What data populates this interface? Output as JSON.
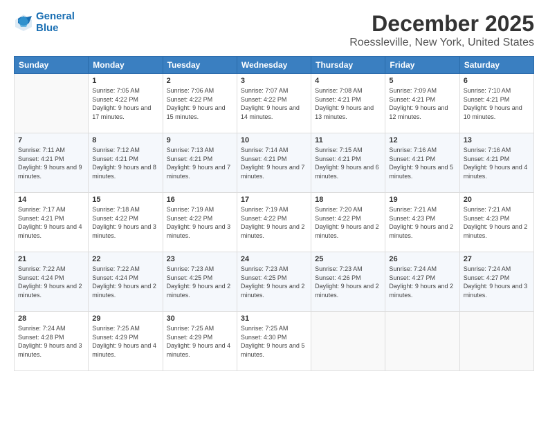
{
  "header": {
    "logo_line1": "General",
    "logo_line2": "Blue",
    "title": "December 2025",
    "subtitle": "Roessleville, New York, United States"
  },
  "weekdays": [
    "Sunday",
    "Monday",
    "Tuesday",
    "Wednesday",
    "Thursday",
    "Friday",
    "Saturday"
  ],
  "weeks": [
    [
      {
        "day": "",
        "sunrise": "",
        "sunset": "",
        "daylight": ""
      },
      {
        "day": "1",
        "sunrise": "Sunrise: 7:05 AM",
        "sunset": "Sunset: 4:22 PM",
        "daylight": "Daylight: 9 hours and 17 minutes."
      },
      {
        "day": "2",
        "sunrise": "Sunrise: 7:06 AM",
        "sunset": "Sunset: 4:22 PM",
        "daylight": "Daylight: 9 hours and 15 minutes."
      },
      {
        "day": "3",
        "sunrise": "Sunrise: 7:07 AM",
        "sunset": "Sunset: 4:22 PM",
        "daylight": "Daylight: 9 hours and 14 minutes."
      },
      {
        "day": "4",
        "sunrise": "Sunrise: 7:08 AM",
        "sunset": "Sunset: 4:21 PM",
        "daylight": "Daylight: 9 hours and 13 minutes."
      },
      {
        "day": "5",
        "sunrise": "Sunrise: 7:09 AM",
        "sunset": "Sunset: 4:21 PM",
        "daylight": "Daylight: 9 hours and 12 minutes."
      },
      {
        "day": "6",
        "sunrise": "Sunrise: 7:10 AM",
        "sunset": "Sunset: 4:21 PM",
        "daylight": "Daylight: 9 hours and 10 minutes."
      }
    ],
    [
      {
        "day": "7",
        "sunrise": "Sunrise: 7:11 AM",
        "sunset": "Sunset: 4:21 PM",
        "daylight": "Daylight: 9 hours and 9 minutes."
      },
      {
        "day": "8",
        "sunrise": "Sunrise: 7:12 AM",
        "sunset": "Sunset: 4:21 PM",
        "daylight": "Daylight: 9 hours and 8 minutes."
      },
      {
        "day": "9",
        "sunrise": "Sunrise: 7:13 AM",
        "sunset": "Sunset: 4:21 PM",
        "daylight": "Daylight: 9 hours and 7 minutes."
      },
      {
        "day": "10",
        "sunrise": "Sunrise: 7:14 AM",
        "sunset": "Sunset: 4:21 PM",
        "daylight": "Daylight: 9 hours and 7 minutes."
      },
      {
        "day": "11",
        "sunrise": "Sunrise: 7:15 AM",
        "sunset": "Sunset: 4:21 PM",
        "daylight": "Daylight: 9 hours and 6 minutes."
      },
      {
        "day": "12",
        "sunrise": "Sunrise: 7:16 AM",
        "sunset": "Sunset: 4:21 PM",
        "daylight": "Daylight: 9 hours and 5 minutes."
      },
      {
        "day": "13",
        "sunrise": "Sunrise: 7:16 AM",
        "sunset": "Sunset: 4:21 PM",
        "daylight": "Daylight: 9 hours and 4 minutes."
      }
    ],
    [
      {
        "day": "14",
        "sunrise": "Sunrise: 7:17 AM",
        "sunset": "Sunset: 4:21 PM",
        "daylight": "Daylight: 9 hours and 4 minutes."
      },
      {
        "day": "15",
        "sunrise": "Sunrise: 7:18 AM",
        "sunset": "Sunset: 4:22 PM",
        "daylight": "Daylight: 9 hours and 3 minutes."
      },
      {
        "day": "16",
        "sunrise": "Sunrise: 7:19 AM",
        "sunset": "Sunset: 4:22 PM",
        "daylight": "Daylight: 9 hours and 3 minutes."
      },
      {
        "day": "17",
        "sunrise": "Sunrise: 7:19 AM",
        "sunset": "Sunset: 4:22 PM",
        "daylight": "Daylight: 9 hours and 2 minutes."
      },
      {
        "day": "18",
        "sunrise": "Sunrise: 7:20 AM",
        "sunset": "Sunset: 4:22 PM",
        "daylight": "Daylight: 9 hours and 2 minutes."
      },
      {
        "day": "19",
        "sunrise": "Sunrise: 7:21 AM",
        "sunset": "Sunset: 4:23 PM",
        "daylight": "Daylight: 9 hours and 2 minutes."
      },
      {
        "day": "20",
        "sunrise": "Sunrise: 7:21 AM",
        "sunset": "Sunset: 4:23 PM",
        "daylight": "Daylight: 9 hours and 2 minutes."
      }
    ],
    [
      {
        "day": "21",
        "sunrise": "Sunrise: 7:22 AM",
        "sunset": "Sunset: 4:24 PM",
        "daylight": "Daylight: 9 hours and 2 minutes."
      },
      {
        "day": "22",
        "sunrise": "Sunrise: 7:22 AM",
        "sunset": "Sunset: 4:24 PM",
        "daylight": "Daylight: 9 hours and 2 minutes."
      },
      {
        "day": "23",
        "sunrise": "Sunrise: 7:23 AM",
        "sunset": "Sunset: 4:25 PM",
        "daylight": "Daylight: 9 hours and 2 minutes."
      },
      {
        "day": "24",
        "sunrise": "Sunrise: 7:23 AM",
        "sunset": "Sunset: 4:25 PM",
        "daylight": "Daylight: 9 hours and 2 minutes."
      },
      {
        "day": "25",
        "sunrise": "Sunrise: 7:23 AM",
        "sunset": "Sunset: 4:26 PM",
        "daylight": "Daylight: 9 hours and 2 minutes."
      },
      {
        "day": "26",
        "sunrise": "Sunrise: 7:24 AM",
        "sunset": "Sunset: 4:27 PM",
        "daylight": "Daylight: 9 hours and 2 minutes."
      },
      {
        "day": "27",
        "sunrise": "Sunrise: 7:24 AM",
        "sunset": "Sunset: 4:27 PM",
        "daylight": "Daylight: 9 hours and 3 minutes."
      }
    ],
    [
      {
        "day": "28",
        "sunrise": "Sunrise: 7:24 AM",
        "sunset": "Sunset: 4:28 PM",
        "daylight": "Daylight: 9 hours and 3 minutes."
      },
      {
        "day": "29",
        "sunrise": "Sunrise: 7:25 AM",
        "sunset": "Sunset: 4:29 PM",
        "daylight": "Daylight: 9 hours and 4 minutes."
      },
      {
        "day": "30",
        "sunrise": "Sunrise: 7:25 AM",
        "sunset": "Sunset: 4:29 PM",
        "daylight": "Daylight: 9 hours and 4 minutes."
      },
      {
        "day": "31",
        "sunrise": "Sunrise: 7:25 AM",
        "sunset": "Sunset: 4:30 PM",
        "daylight": "Daylight: 9 hours and 5 minutes."
      },
      {
        "day": "",
        "sunrise": "",
        "sunset": "",
        "daylight": ""
      },
      {
        "day": "",
        "sunrise": "",
        "sunset": "",
        "daylight": ""
      },
      {
        "day": "",
        "sunrise": "",
        "sunset": "",
        "daylight": ""
      }
    ]
  ]
}
